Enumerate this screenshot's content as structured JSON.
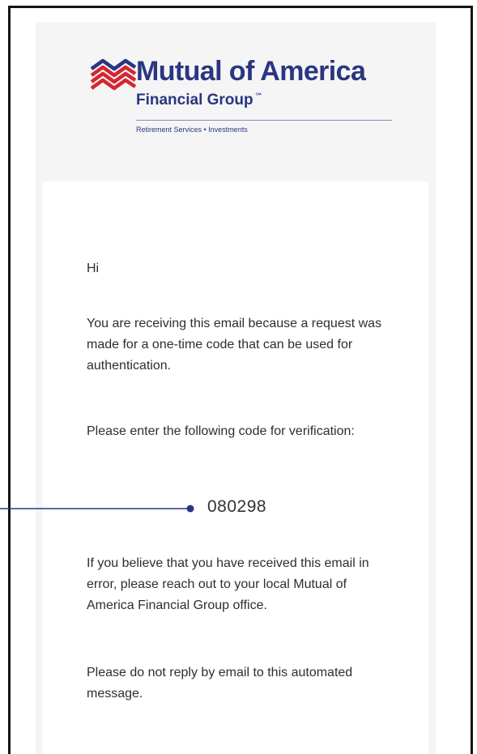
{
  "brand": {
    "name": "Mutual of America",
    "subname": "Financial Group",
    "service_mark": "℠",
    "tagline": "Retirement Services • Investments",
    "primary_color": "#2a3680",
    "flag_red": "#d6262f"
  },
  "email": {
    "greeting": "Hi",
    "paragraph_1": "You are receiving this email because a request was made for a one-time code that can be used for authentication.",
    "paragraph_2": "Please enter the following code for verification:",
    "code": "080298",
    "paragraph_3": "If you believe that you have received this email in error, please reach out to your local Mutual of America Financial Group office.",
    "paragraph_4": "Please do not reply by email to this automated message."
  },
  "annotation": {
    "color": "#2a3680"
  }
}
